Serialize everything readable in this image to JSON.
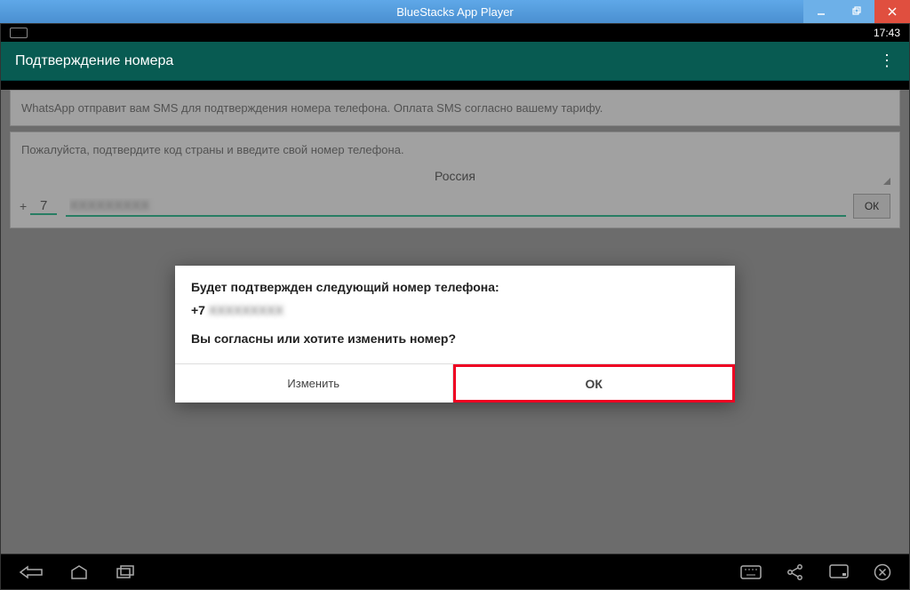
{
  "window": {
    "title": "BlueStacks App Player"
  },
  "status": {
    "time": "17:43"
  },
  "actionbar": {
    "title": "Подтверждение номера"
  },
  "info1": "WhatsApp отправит вам SMS для подтверждения номера телефона. Оплата SMS согласно вашему тарифу.",
  "prompt": "Пожалуйста, подтвердите код страны и введите свой номер телефона.",
  "country": "Россия",
  "phone": {
    "plus": "+",
    "cc": "7",
    "number": "XXXXXXXXX"
  },
  "ok_label": "ОК",
  "dialog": {
    "msg1": "Будет подтвержден следующий номер телефона:",
    "phone_prefix": "+7 ",
    "phone_num": "XXXXXXXXX",
    "msg2": "Вы согласны или хотите изменить номер?",
    "change": "Изменить",
    "ok": "ОК"
  }
}
